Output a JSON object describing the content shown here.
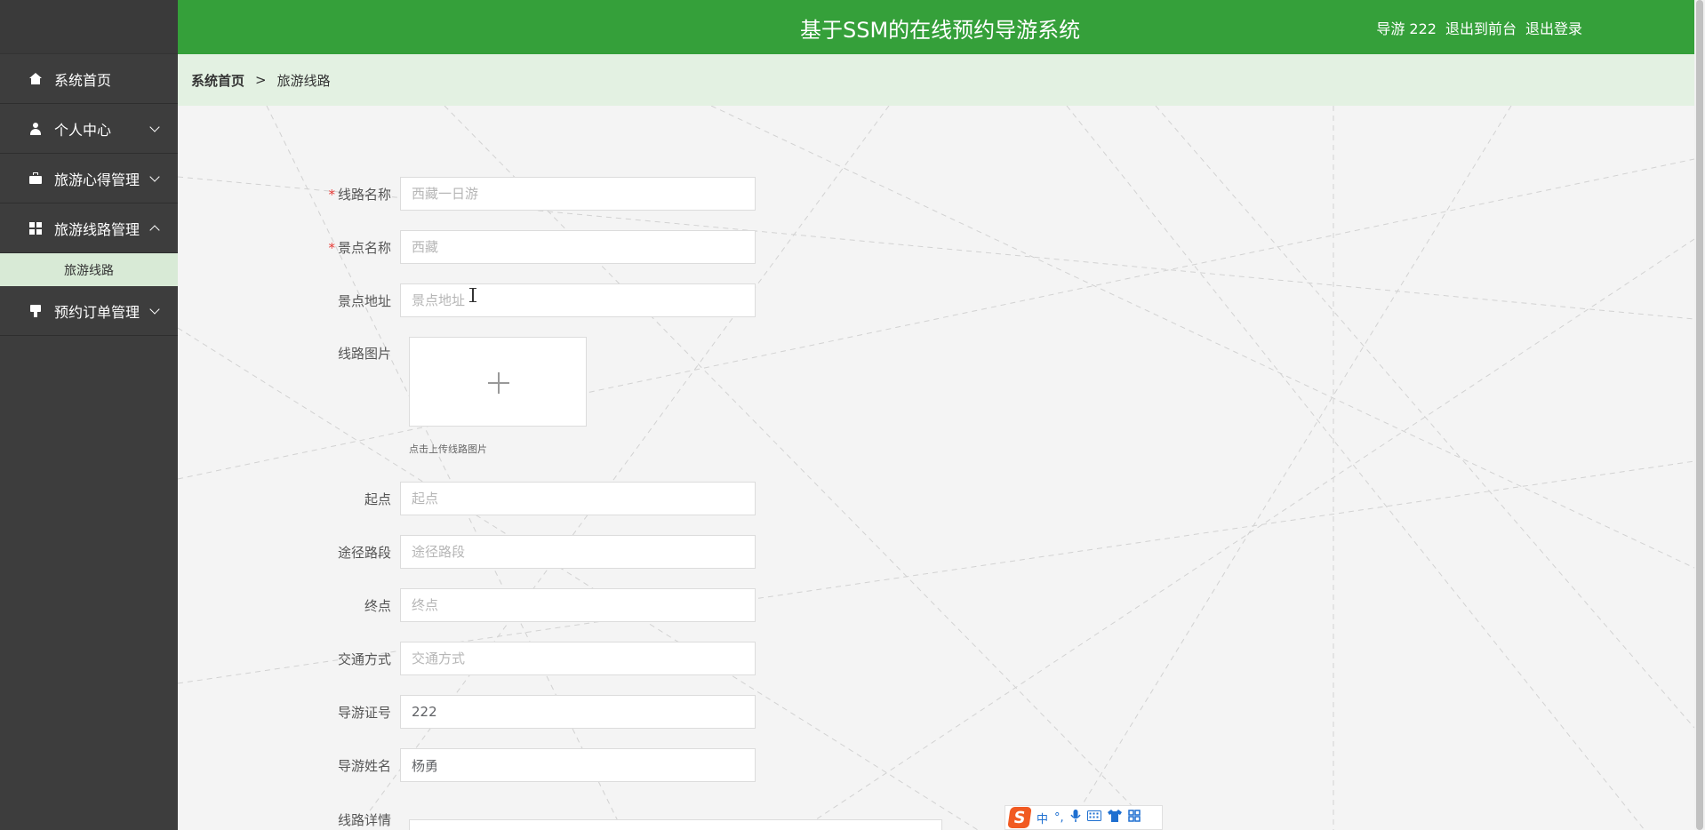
{
  "app": {
    "title": "基于SSM的在线预约导游系统"
  },
  "header": {
    "user": "导游 222",
    "to_front": "退出到前台",
    "logout": "退出登录"
  },
  "sidebar": {
    "items": [
      {
        "label": "系统首页",
        "icon": "home-icon"
      },
      {
        "label": "个人中心",
        "icon": "user-icon"
      },
      {
        "label": "旅游心得管理",
        "icon": "briefcase-icon"
      },
      {
        "label": "旅游线路管理",
        "icon": "grid-icon",
        "expanded": true
      },
      {
        "label": "预约订单管理",
        "icon": "stamp-icon"
      }
    ],
    "submenu": [
      {
        "label": "旅游线路"
      }
    ]
  },
  "breadcrumb": {
    "home": "系统首页",
    "separator": ">",
    "current": "旅游线路"
  },
  "form": {
    "route_name": {
      "label": "线路名称",
      "required": "*",
      "placeholder": "西藏一日游"
    },
    "spot_name": {
      "label": "景点名称",
      "required": "*",
      "placeholder": "西藏"
    },
    "spot_address": {
      "label": "景点地址",
      "placeholder": "景点地址"
    },
    "route_image": {
      "label": "线路图片",
      "hint": "点击上传线路图片"
    },
    "start": {
      "label": "起点",
      "placeholder": "起点"
    },
    "via": {
      "label": "途径路段",
      "placeholder": "途径路段"
    },
    "end": {
      "label": "终点",
      "placeholder": "终点"
    },
    "transport": {
      "label": "交通方式",
      "placeholder": "交通方式"
    },
    "guide_id": {
      "label": "导游证号",
      "value": "222"
    },
    "guide_name": {
      "label": "导游姓名",
      "value": "杨勇"
    },
    "details": {
      "label": "线路详情"
    }
  },
  "ime": {
    "logo": "S",
    "mode": "中",
    "punct": "°,",
    "icons": [
      "mic-icon",
      "keyboard-icon",
      "skin-icon",
      "apps-icon"
    ]
  },
  "colors": {
    "header": "#35a03a",
    "sidebar": "#3d3d3d",
    "breadcrumb_bg": "#e3f1e2",
    "submenu_active": "#d8ead6",
    "required": "#e53935"
  }
}
